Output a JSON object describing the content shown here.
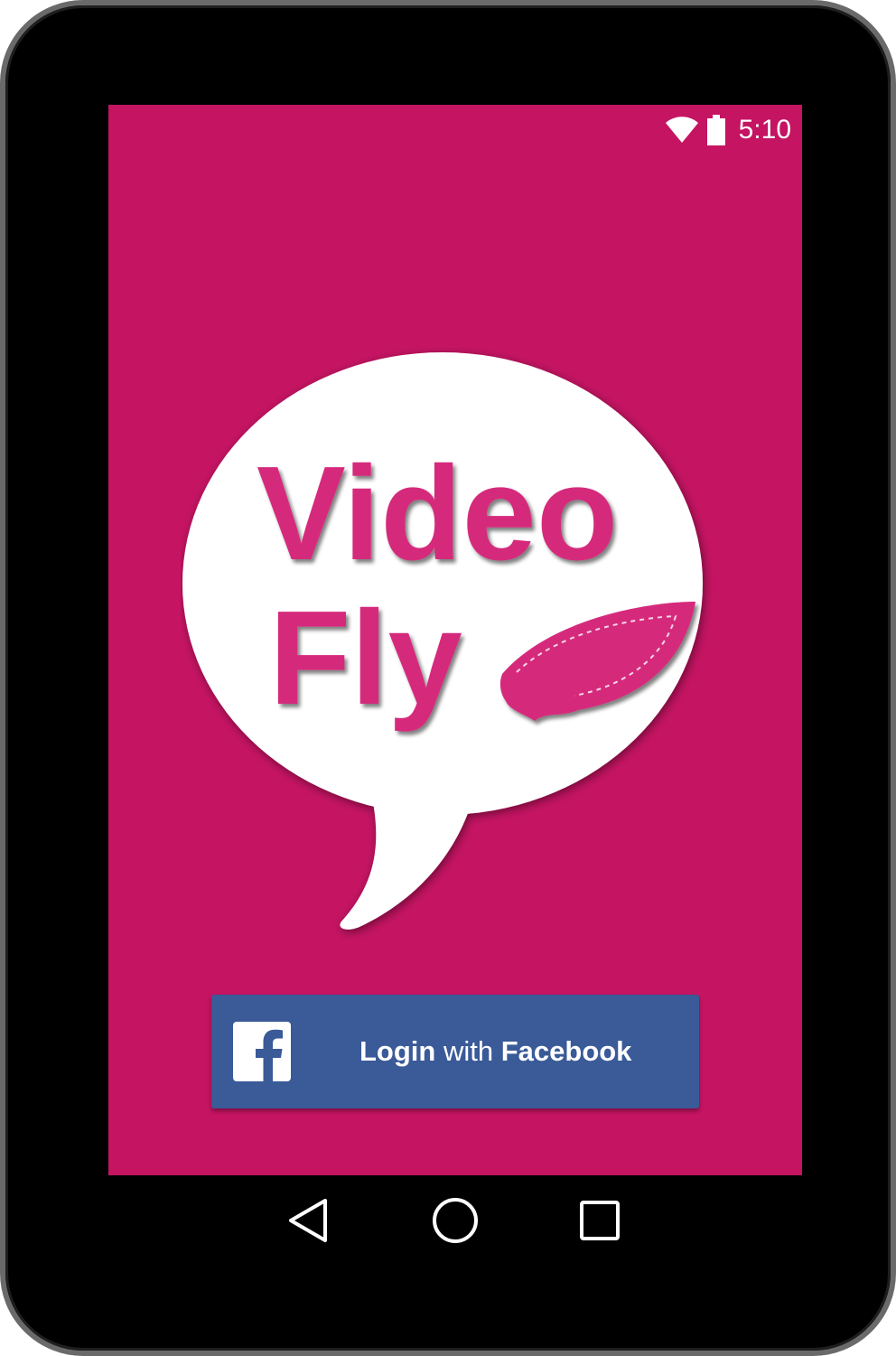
{
  "status_bar": {
    "time": "5:10",
    "icons": [
      "wifi-icon",
      "battery-icon"
    ]
  },
  "logo": {
    "line1": "Video",
    "line2": "Fly",
    "icons": [
      "speech-bubble-icon",
      "wing-icon"
    ]
  },
  "login_button": {
    "prefix": "Login",
    "middle": " with ",
    "brand": "Facebook",
    "icon": "facebook-icon"
  },
  "nav_bar": {
    "icons": [
      "back-icon",
      "home-icon",
      "recents-icon"
    ]
  },
  "colors": {
    "background": "#c41462",
    "logo_pink": "#d52a7c",
    "facebook_blue": "#3a5a98",
    "bubble": "#ffffff"
  }
}
